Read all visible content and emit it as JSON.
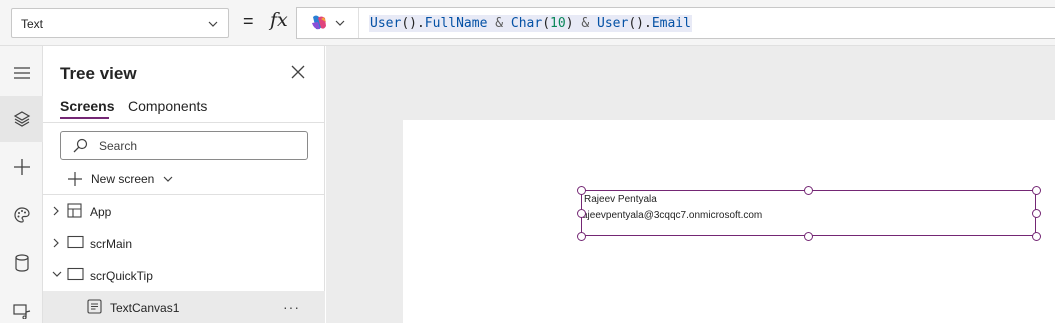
{
  "formula_bar": {
    "property": "Text",
    "equals": "=",
    "fx": "fx",
    "formula_tokens": [
      {
        "text": "User",
        "cls": "fn"
      },
      {
        "text": "().",
        "cls": ""
      },
      {
        "text": "FullName",
        "cls": "fn"
      },
      {
        "text": " & ",
        "cls": "op"
      },
      {
        "text": "Char",
        "cls": "fn"
      },
      {
        "text": "(",
        "cls": ""
      },
      {
        "text": "10",
        "cls": "num"
      },
      {
        "text": ")",
        "cls": ""
      },
      {
        "text": " & ",
        "cls": "op"
      },
      {
        "text": "User",
        "cls": "fn"
      },
      {
        "text": "().",
        "cls": ""
      },
      {
        "text": "Email",
        "cls": "fn"
      }
    ]
  },
  "rail": {
    "items": [
      {
        "name": "hamburger-icon"
      },
      {
        "name": "layers-icon",
        "active": true
      },
      {
        "name": "plus-icon"
      },
      {
        "name": "palette-icon"
      },
      {
        "name": "database-icon"
      },
      {
        "name": "media-icon"
      }
    ]
  },
  "tree_view": {
    "title": "Tree view",
    "tabs": [
      "Screens",
      "Components"
    ],
    "search_placeholder": "Search",
    "new_screen": "New screen",
    "nodes": [
      {
        "label": "App",
        "icon": "app-icon",
        "expanded": false
      },
      {
        "label": "scrMain",
        "icon": "screen-icon",
        "expanded": false
      },
      {
        "label": "scrQuickTip",
        "icon": "screen-icon",
        "expanded": true
      },
      {
        "label": "TextCanvas1",
        "icon": "text-control-icon",
        "child": true,
        "selected": true
      }
    ],
    "more": "···"
  },
  "canvas": {
    "text_line1": "Rajeev Pentyala",
    "text_line2": "ajeevpentyala@3cqqc7.onmicrosoft.com"
  },
  "colors": {
    "accent": "#742774",
    "canvas_bg": "#ececec",
    "code_fn": "#0451a5",
    "code_num": "#098658"
  }
}
